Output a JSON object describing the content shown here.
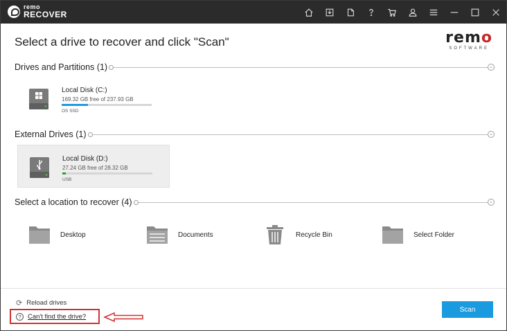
{
  "app": {
    "logo_small": "remo",
    "logo_big": "RECOVER"
  },
  "header": {
    "title": "Select a drive to recover and click \"Scan\"",
    "brand_name_left": "rem",
    "brand_name_right": "o",
    "brand_sub": "SOFTWARE"
  },
  "sections": {
    "drives": "Drives and Partitions",
    "drives_count": "(1)",
    "external": "External Drives",
    "external_count": "(1)",
    "locations": "Select a location to recover",
    "locations_count": "(4)"
  },
  "drives": [
    {
      "name": "Local Disk (C:)",
      "free": "169.32 GB free of 237.93 GB",
      "type": "OS SSD",
      "used_fraction": 0.29,
      "color": "#1e9be0",
      "icon": "windows-drive-icon"
    }
  ],
  "external_drives": [
    {
      "name": "Local Disk (D:)",
      "free": "27.24 GB free of 28.32 GB",
      "type": "USB",
      "used_fraction": 0.04,
      "color": "#2e9e3f",
      "icon": "usb-drive-icon"
    }
  ],
  "locations": [
    {
      "label": "Desktop",
      "icon": "desktop-folder-icon"
    },
    {
      "label": "Documents",
      "icon": "documents-folder-icon"
    },
    {
      "label": "Recycle Bin",
      "icon": "recycle-bin-icon"
    },
    {
      "label": "Select Folder",
      "icon": "folder-icon"
    }
  ],
  "footer": {
    "reload": "Reload drives",
    "cant_find": "Can't find the drive?",
    "scan": "Scan"
  },
  "colors": {
    "accent": "#1a9be0",
    "highlight": "#d32f2f",
    "titlebar": "#2b2b2b"
  }
}
